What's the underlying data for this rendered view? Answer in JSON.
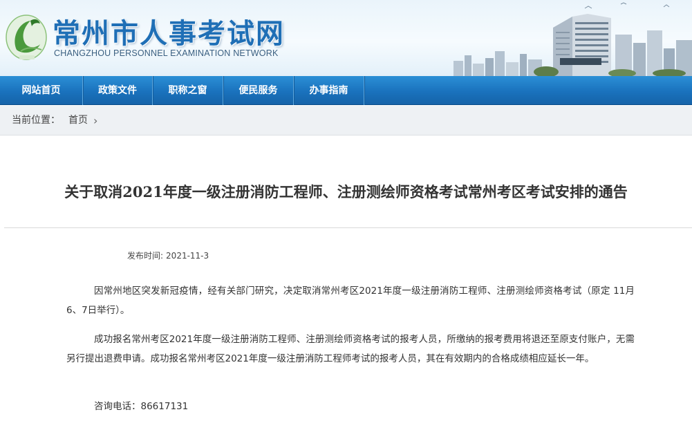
{
  "site": {
    "title_cn": "常州市人事考试网",
    "title_en": "CHANGZHOU PERSONNEL EXAMINATION NETWORK",
    "logo_icon": "swan-logo-icon",
    "brand_color": "#1f6fb6",
    "nav_color": "#1a72bd"
  },
  "nav": {
    "items": [
      {
        "label": "网站首页"
      },
      {
        "label": "政策文件"
      },
      {
        "label": "职称之窗"
      },
      {
        "label": "便民服务"
      },
      {
        "label": "办事指南"
      }
    ]
  },
  "breadcrumb": {
    "label": "当前位置：",
    "home": "首页",
    "chevron": "›"
  },
  "article": {
    "title": "关于取消2021年度一级注册消防工程师、注册测绘师资格考试常州考区考试安排的通告",
    "publish_label": "发布时间:",
    "publish_date": "2021-11-3",
    "paragraphs": [
      "因常州地区突发新冠疫情，经有关部门研究，决定取消常州考区2021年度一级注册消防工程师、注册测绘师资格考试（原定 11月6、7日举行）。",
      "成功报名常州考区2021年度一级注册消防工程师、注册测绘师资格考试的报考人员，所缴纳的报考费用将退还至原支付账户，无需另行提出退费申请。成功报名常州考区2021年度一级注册消防工程师考试的报考人员，其在有效期内的合格成绩相应延长一年。"
    ],
    "contact_label": "咨询电话：",
    "contact_phone": "86617131"
  }
}
